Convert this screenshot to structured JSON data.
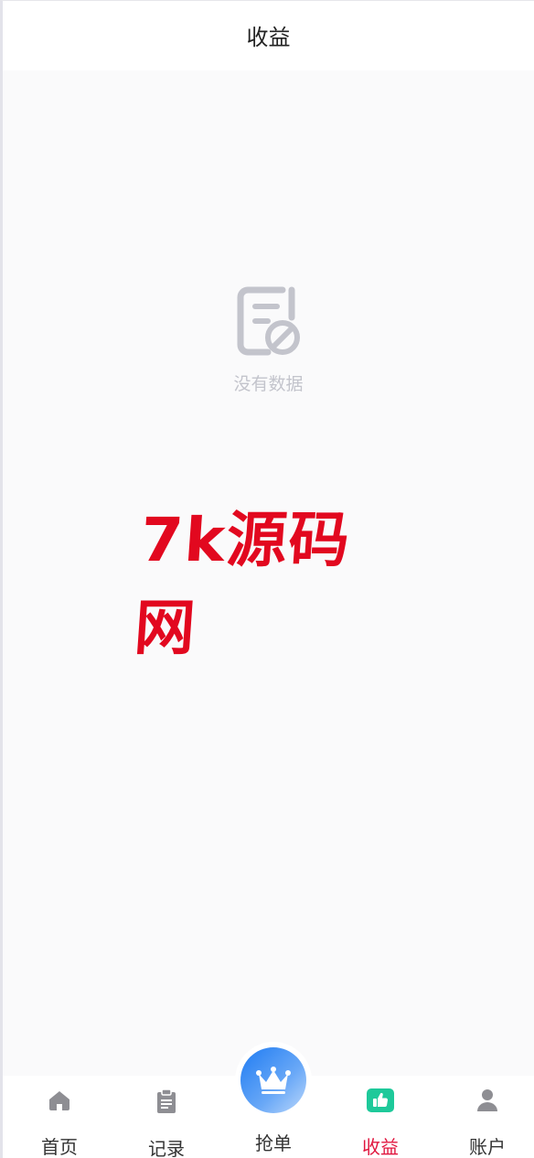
{
  "header": {
    "title": "收益"
  },
  "empty_state": {
    "icon": "no-data-document-icon",
    "text": "没有数据"
  },
  "watermark": {
    "text": "7k源码网",
    "color": "#e2081f"
  },
  "tabbar": {
    "tabs": [
      {
        "label": "首页",
        "icon": "home-icon",
        "active": false
      },
      {
        "label": "记录",
        "icon": "clipboard-icon",
        "active": false
      },
      {
        "label": "抢单",
        "icon": "crown-icon",
        "active": false
      },
      {
        "label": "收益",
        "icon": "thumbs-up-icon",
        "active": true
      },
      {
        "label": "账户",
        "icon": "user-icon",
        "active": false
      }
    ],
    "active_color": "#e0163e",
    "grab_button_color": "#1f7cf2",
    "income_icon_color": "#1ec99a"
  }
}
